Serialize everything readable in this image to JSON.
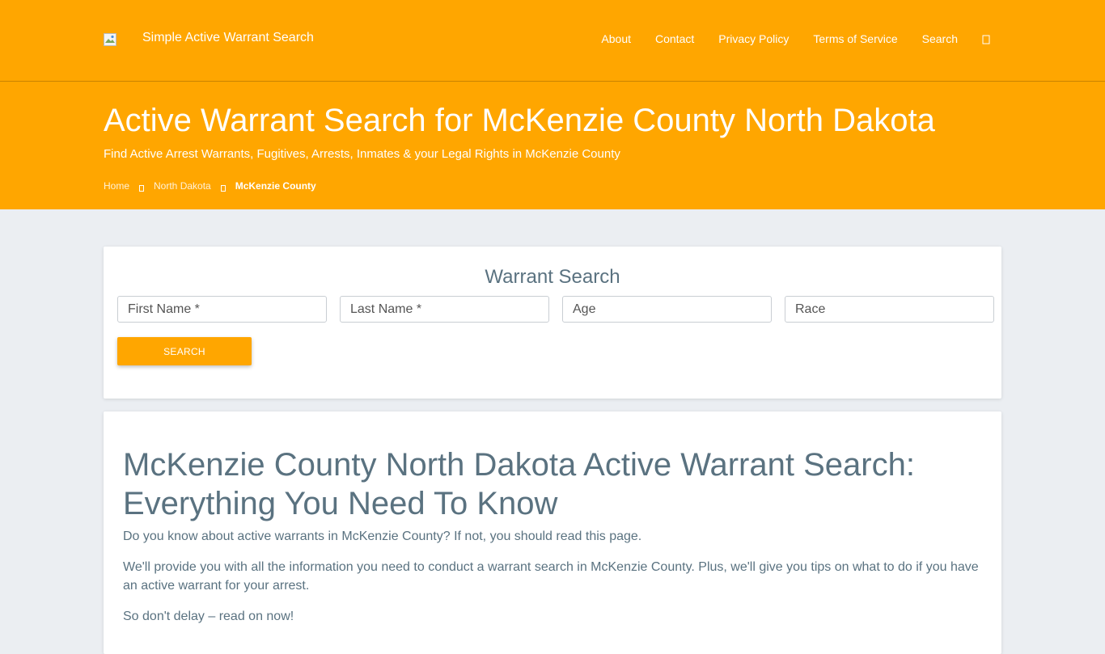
{
  "header": {
    "logo_icon": "broken-image-icon",
    "brand": "Simple Active Warrant Search",
    "nav": [
      "About",
      "Contact",
      "Privacy Policy",
      "Terms of Service",
      "Search"
    ],
    "menu_icon": "menu-icon"
  },
  "hero": {
    "title": "Active Warrant Search for McKenzie County North Dakota",
    "subtitle": "Find Active Arrest Warrants, Fugitives, Arrests, Inmates & your Legal Rights in McKenzie County",
    "breadcrumb": [
      "Home",
      "North Dakota",
      "McKenzie County"
    ]
  },
  "search": {
    "title": "Warrant Search",
    "first_name_placeholder": "First Name *",
    "last_name_placeholder": "Last Name *",
    "age_placeholder": "Age",
    "race_placeholder": "Race",
    "button": "SEARCH"
  },
  "article": {
    "heading": "McKenzie County North Dakota Active Warrant Search: Everything You Need To Know",
    "paragraphs": [
      "Do you know about active warrants in McKenzie County? If not, you should read this page.",
      "We'll provide you with all the information you need to conduct a warrant search in McKenzie County. Plus, we'll give you tips on what to do if you have an active warrant for your arrest.",
      "So don't delay – read on now!"
    ]
  },
  "colors": {
    "accent": "#ffa600",
    "page_bg": "#ebeef2",
    "text": "#5a7280"
  }
}
